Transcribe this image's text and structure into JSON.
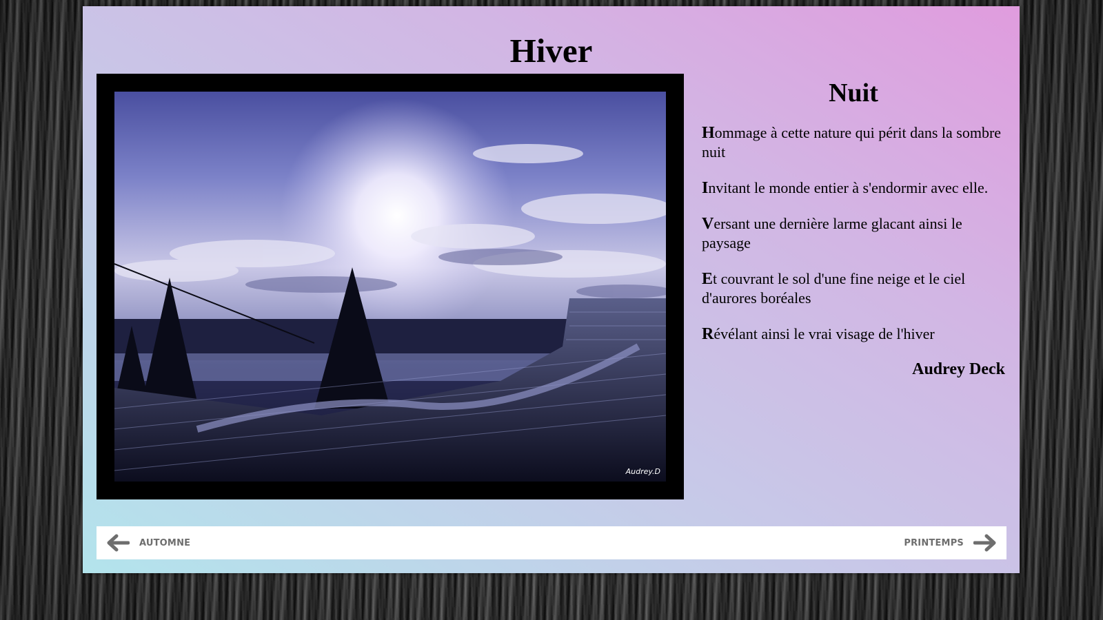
{
  "page": {
    "title": "Hiver"
  },
  "photo": {
    "credit": "Audrey.D"
  },
  "poem": {
    "title": "Nuit",
    "verses": [
      {
        "initial": "H",
        "rest": "ommage à cette nature qui périt dans la sombre nuit"
      },
      {
        "initial": "I",
        "rest": "nvitant le monde entier à s'endormir avec elle."
      },
      {
        "initial": "V",
        "rest": "ersant une dernière larme glacant ainsi le paysage"
      },
      {
        "initial": "E",
        "rest": "t couvrant le sol d'une fine neige et le ciel d'aurores boréales"
      },
      {
        "initial": "R",
        "rest": "évélant ainsi le vrai visage de l'hiver"
      }
    ],
    "author": "Audrey Deck"
  },
  "nav": {
    "prev_label": "AUTOMNE",
    "next_label": "PRINTEMPS",
    "prev_icon": "arrow-left-icon",
    "next_icon": "arrow-right-icon"
  },
  "colors": {
    "panel_gradient_start": "#b3e4ec",
    "panel_gradient_end": "#e09cde",
    "nav_text": "#6e6e6e"
  }
}
